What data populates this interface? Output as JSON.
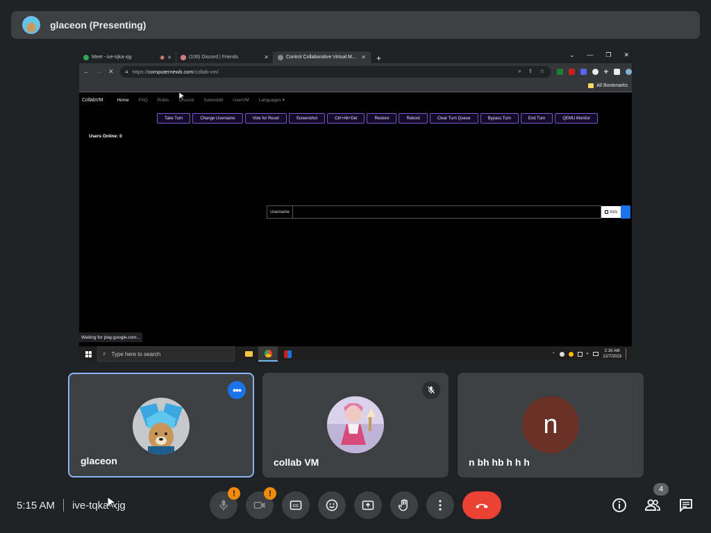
{
  "presenter": {
    "name": "glaceon (Presenting)"
  },
  "browser": {
    "tabs": [
      {
        "title": "Meet - ive-tqka-xjg",
        "favicon_color": "#34a853"
      },
      {
        "title": "(106) Discord | Friends",
        "favicon_color": "#c97c8a"
      },
      {
        "title": "Control Collaborative Virtual M...",
        "favicon_color": "#888888"
      }
    ],
    "new_tab": "+",
    "window_controls": [
      "⌄",
      "—",
      "❐",
      "✕"
    ],
    "url": {
      "scheme": "https://",
      "host": "computernewb.com",
      "path": "/collab-vm/"
    },
    "bookmarks_label": "All Bookmarks",
    "status": "Waiting for play.google.com..."
  },
  "collabvm": {
    "brand": "CollabVM",
    "nav": [
      "Home",
      "FAQ",
      "Rules",
      "Discord",
      "Subreddit",
      "UserVM",
      "Languages ▾"
    ],
    "buttons": [
      "Take Turn",
      "Change Username",
      "Vote for Reset",
      "Screenshot",
      "Ctrl+Alt+Del",
      "Restore",
      "Reboot",
      "Clear Turn Queue",
      "Bypass Turn",
      "End Turn",
      "QEMU Monitor"
    ],
    "users_online": "Users Online: 0",
    "chat_label": "Username",
    "xss_label": "XSS"
  },
  "taskbar": {
    "search_placeholder": "Type here to search",
    "time": "2:16 AM",
    "date": "12/7/2023"
  },
  "participants": [
    {
      "name": "glaceon",
      "avatar": "glaceon-dog"
    },
    {
      "name": "collab VM",
      "avatar": "anime-character",
      "muted": true
    },
    {
      "name": "n bh hb h h h",
      "avatar_letter": "n",
      "avatar_color": "#6b3127"
    }
  ],
  "meeting": {
    "time": "5:15 AM",
    "code": "ive-tqka-xjg",
    "people_count": "4",
    "mic_warning": "!",
    "camera_warning": "!"
  },
  "colors": {
    "background": "#202124",
    "tile": "#3c4043",
    "accent": "#1a73e8",
    "end_call": "#ea4335",
    "warning": "#f28b0c",
    "vm_button_border": "#7a58c9"
  }
}
